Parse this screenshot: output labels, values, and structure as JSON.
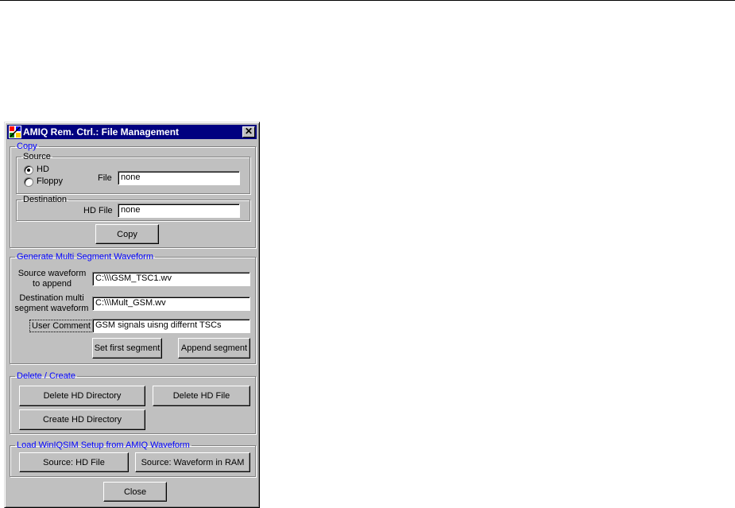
{
  "window": {
    "title": "AMIQ Rem. Ctrl.: File Management",
    "close_glyph": "✕"
  },
  "copy": {
    "legend": "Copy",
    "source": {
      "legend": "Source",
      "options": [
        "HD",
        "Floppy"
      ],
      "selected": "HD",
      "file_label": "File",
      "file_value": "none"
    },
    "destination": {
      "legend": "Destination",
      "hd_file_label": "HD File",
      "hd_file_value": "none"
    },
    "copy_button": "Copy"
  },
  "multi_segment": {
    "legend": "Generate Multi Segment Waveform",
    "source_label_line1": "Source waveform",
    "source_label_line2": "to append",
    "source_value": "C:\\\\\\GSM_TSC1.wv",
    "dest_label_line1": "Destination multi",
    "dest_label_line2": "segment waveform",
    "dest_value": "C:\\\\\\Mult_GSM.wv",
    "user_comment_label": "User Comment",
    "user_comment_value": "GSM signals uisng differnt TSCs",
    "set_first_button": "Set first segment",
    "append_button": "Append segment"
  },
  "delete_create": {
    "legend": "Delete / Create",
    "delete_dir_button": "Delete HD Directory",
    "delete_file_button": "Delete HD File",
    "create_dir_button": "Create HD Directory"
  },
  "load_setup": {
    "legend": "Load WinIQSIM Setup from AMIQ Waveform",
    "source_hd_button": "Source: HD File",
    "source_ram_button": "Source: Waveform in RAM"
  },
  "close_button": "Close",
  "colors": {
    "titlebar": "#000080",
    "face": "#c0c0c0",
    "legend_blue": "#0000ff"
  }
}
